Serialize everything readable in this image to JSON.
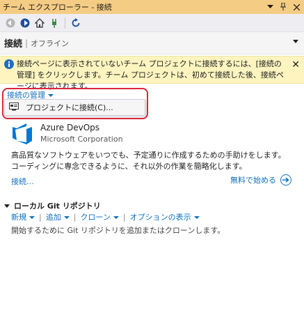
{
  "window": {
    "title": "チーム エクスプローラー - 接続"
  },
  "toolbar": {
    "buttons": [
      "back-icon",
      "forward-icon",
      "home-icon",
      "plug-icon",
      "refresh-icon"
    ]
  },
  "header": {
    "title": "接続",
    "separator": "|",
    "status": "オフライン"
  },
  "info": {
    "text": "接続ページに表示されていないチーム プロジェクトに接続するには、[接続の管理] をクリックします。チーム プロジェクトは、初めて接続した後、接続ページに表示されます。",
    "close": "✕"
  },
  "manage": {
    "label": "接続の管理",
    "menu_item": "プロジェクトに接続(C)..."
  },
  "azure": {
    "title": "Azure DevOps",
    "subtitle": "Microsoft Corporation",
    "description": "高品質なソフトウェアをいつでも、予定通りに作成するための手助けをします。コーディングに専念できるように、それ以外の作業を簡略化します。",
    "connect": "接続...",
    "free_start": "無料で始める"
  },
  "git": {
    "header": "ローカル Git リポジトリ",
    "actions": [
      "新規",
      "追加",
      "クローン",
      "オプションの表示"
    ],
    "empty_text": "開始するために Git リポジトリを追加またはクローンします。"
  },
  "colors": {
    "titlebar": "#f5cc84",
    "link": "#0e70c0",
    "info_bg": "#fdf4bf",
    "highlight": "#d9263a"
  }
}
